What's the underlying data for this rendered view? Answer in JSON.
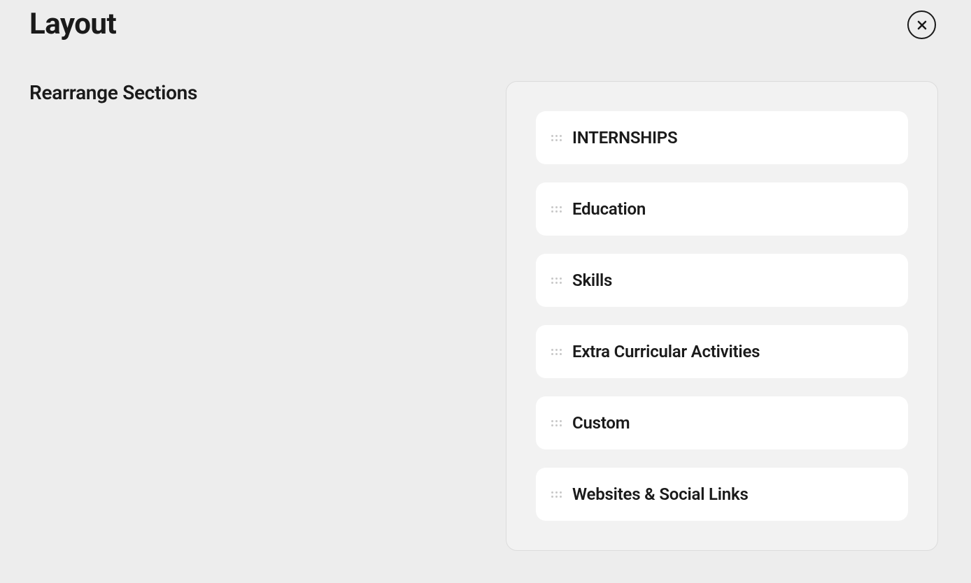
{
  "header": {
    "title": "Layout"
  },
  "subtitle": "Rearrange Sections",
  "sections": [
    {
      "label": "INTERNSHIPS"
    },
    {
      "label": "Education"
    },
    {
      "label": "Skills"
    },
    {
      "label": "Extra Curricular Activities"
    },
    {
      "label": "Custom"
    },
    {
      "label": "Websites & Social Links"
    }
  ]
}
